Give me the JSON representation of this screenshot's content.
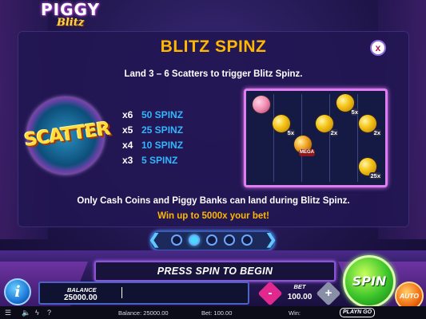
{
  "game": {
    "logo_line1": "PIGGY",
    "logo_line2": "Blitz"
  },
  "paytable": {
    "title": "BLITZ SPINZ",
    "close_label": "x",
    "subtitle": "Land 3 – 6 Scatters to trigger Blitz Spinz.",
    "scatter_label": "SCATTER",
    "payouts": [
      {
        "count": "x6",
        "spins": "50 SPINZ"
      },
      {
        "count": "x5",
        "spins": "25 SPINZ"
      },
      {
        "count": "x4",
        "spins": "10 SPINZ"
      },
      {
        "count": "x3",
        "spins": "5 SPINZ"
      }
    ],
    "coins": [
      {
        "label": "5x"
      },
      {
        "label": "5x"
      },
      {
        "label": "2x"
      },
      {
        "label": "2x"
      },
      {
        "label": "25x"
      },
      {
        "label": "MEGA"
      }
    ],
    "info_line1": "Only Cash Coins and Piggy Banks can land during Blitz Spinz.",
    "info_line2": "Win up to 5000x your bet!"
  },
  "pager": {
    "prev": "❮",
    "next": "❯",
    "pages": 5,
    "active_index": 1
  },
  "message_bar": "PRESS SPIN TO BEGIN",
  "controls": {
    "info_label": "i",
    "balance_label": "BALANCE",
    "balance_value": "25000.00",
    "minus_label": "-",
    "bet_label": "BET",
    "bet_value": "100.00",
    "plus_label": "+",
    "spin_label": "SPIN",
    "auto_label": "AUTO"
  },
  "status_bar": {
    "icons": [
      "menu-icon",
      "sound-icon",
      "turbo-icon",
      "help-icon"
    ],
    "help_glyph": "?",
    "balance": "Balance: 25000.00",
    "bet": "Bet: 100.00",
    "win": "Win:",
    "brand": "PLAYN GO"
  }
}
